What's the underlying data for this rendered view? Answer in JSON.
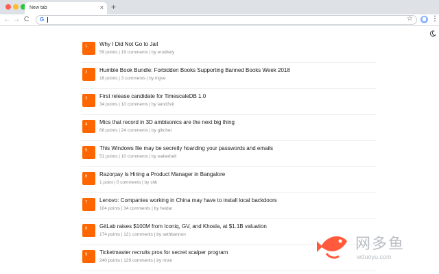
{
  "browser": {
    "tab_title": "New tab",
    "tab_close": "×",
    "new_tab": "+",
    "nav_back": "←",
    "nav_forward": "→",
    "nav_reload": "C",
    "omnibox_icon": "G",
    "omnibox_value": "",
    "star": "☆",
    "menu": "⋮"
  },
  "icons": {
    "theme_toggle": "moon-icon",
    "extension": "extension-icon"
  },
  "colors": {
    "accent": "#ff6600",
    "title_text": "#1a1a1a",
    "meta_text": "#8a8a8a"
  },
  "stories": [
    {
      "rank": "1",
      "title": "Why I Did Not Go to Jail",
      "meta": "59 points | 19 comments | by eruditely"
    },
    {
      "rank": "2",
      "title": "Humble Book Bundle: Forbidden Books Supporting Banned Books Week 2018",
      "meta": "16 points | 3 comments | by ingve"
    },
    {
      "rank": "3",
      "title": "First release candidate for TimescaleDB 1.0",
      "meta": "34 points | 10 comments | by iamd3vil"
    },
    {
      "rank": "4",
      "title": "Mics that record in 3D ambisonics are the next big thing",
      "meta": "68 points | 24 comments | by glitcher"
    },
    {
      "rank": "5",
      "title": "This Windows file may be secretly hoarding your passwords and emails",
      "meta": "51 points | 10 comments | by walterbell"
    },
    {
      "rank": "6",
      "title": "Razorpay Is Hiring a Product Manager in Bangalore",
      "meta": "1 point | 0 comments | by shk"
    },
    {
      "rank": "7",
      "title": "Lenovo: Companies working in China may have to install local backdoors",
      "meta": "104 points | 34 comments | by heidar"
    },
    {
      "rank": "8",
      "title": "GitLab raises $100M from Iconiq, GV, and Khosla, at $1.1B valuation",
      "meta": "174 points | 121 comments | by sethbannon"
    },
    {
      "rank": "9",
      "title": "Ticketmaster recruits pros for secret scalper program",
      "meta": "240 points | 129 comments | by rinze"
    }
  ],
  "watermark": {
    "text": "网多鱼",
    "url": "wduoyu.com"
  }
}
